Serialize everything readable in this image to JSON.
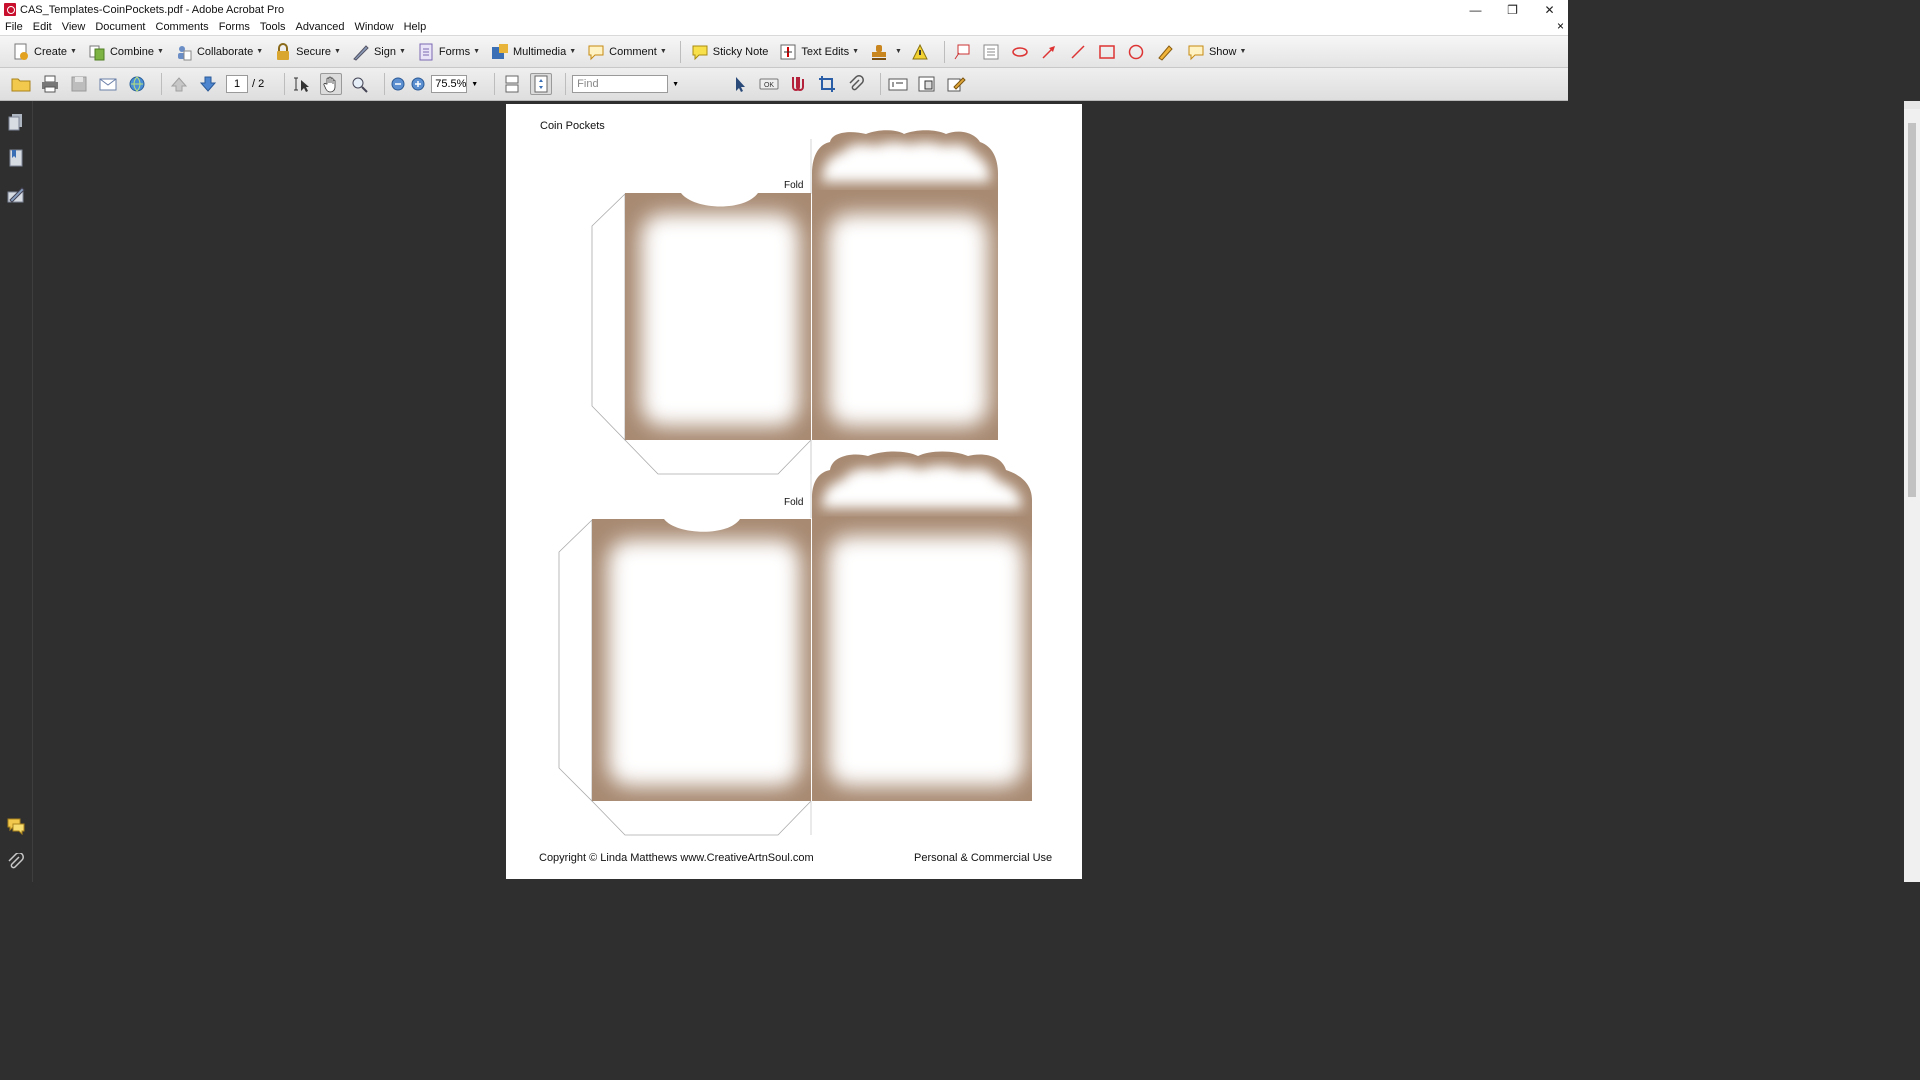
{
  "window": {
    "title": "CAS_Templates-CoinPockets.pdf - Adobe Acrobat Pro",
    "minimize": "—",
    "restore": "❐",
    "close": "✕"
  },
  "menu": [
    "File",
    "Edit",
    "View",
    "Document",
    "Comments",
    "Forms",
    "Tools",
    "Advanced",
    "Window",
    "Help"
  ],
  "menu_close": "×",
  "toolbar": {
    "create": "Create",
    "combine": "Combine",
    "collaborate": "Collaborate",
    "secure": "Secure",
    "sign": "Sign",
    "forms": "Forms",
    "multimedia": "Multimedia",
    "comment": "Comment",
    "sticky_note": "Sticky Note",
    "text_edits": "Text Edits",
    "show": "Show"
  },
  "nav": {
    "current_page": "1",
    "total_pages": "/ 2",
    "zoom": "75.5%",
    "find_placeholder": "Find"
  },
  "document": {
    "heading": "Coin Pockets",
    "fold_label": "Fold",
    "copyright": "Copyright © Linda Matthews www.CreativeArtnSoul.com",
    "usage": "Personal & Commercial Use"
  },
  "colors": {
    "pocket_brown": "#a88a72",
    "dark_bg": "#2f2f2f"
  }
}
